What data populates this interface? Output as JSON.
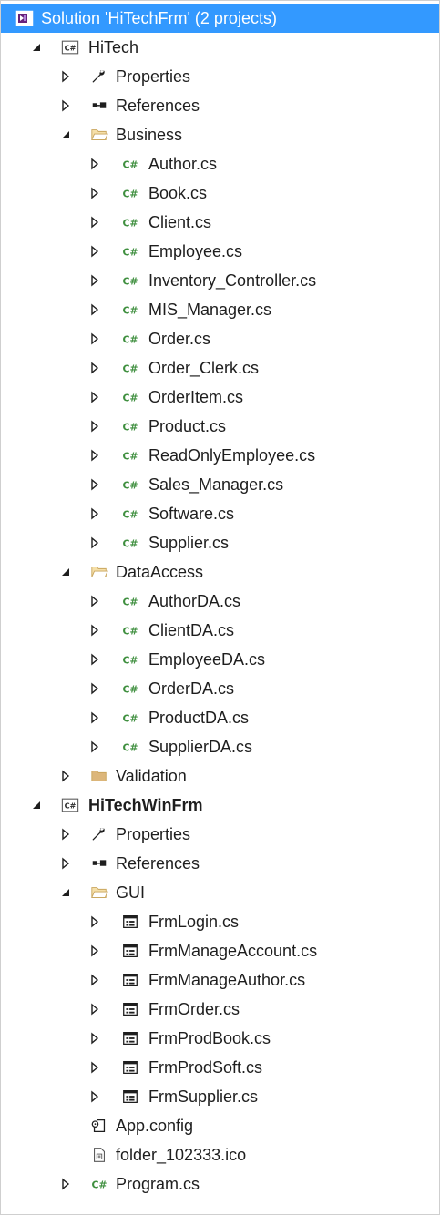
{
  "solution_explorer": {
    "solution": {
      "label": "Solution 'HiTechFrm' (2 projects)",
      "icon": "visual-studio-solution-icon",
      "state": "selected"
    },
    "projects": [
      {
        "label": "HiTech",
        "icon": "csharp-project-icon",
        "expanded": true,
        "bold": false,
        "properties_label": "Properties",
        "references_label": "References",
        "folders": [
          {
            "label": "Business",
            "expanded": true,
            "items": [
              {
                "label": "Author.cs",
                "icon": "csharp-file-icon"
              },
              {
                "label": "Book.cs",
                "icon": "csharp-file-icon"
              },
              {
                "label": "Client.cs",
                "icon": "csharp-file-icon"
              },
              {
                "label": "Employee.cs",
                "icon": "csharp-file-icon"
              },
              {
                "label": "Inventory_Controller.cs",
                "icon": "csharp-file-icon"
              },
              {
                "label": "MIS_Manager.cs",
                "icon": "csharp-file-icon"
              },
              {
                "label": "Order.cs",
                "icon": "csharp-file-icon"
              },
              {
                "label": "Order_Clerk.cs",
                "icon": "csharp-file-icon"
              },
              {
                "label": "OrderItem.cs",
                "icon": "csharp-file-icon"
              },
              {
                "label": "Product.cs",
                "icon": "csharp-file-icon"
              },
              {
                "label": "ReadOnlyEmployee.cs",
                "icon": "csharp-file-icon"
              },
              {
                "label": "Sales_Manager.cs",
                "icon": "csharp-file-icon"
              },
              {
                "label": "Software.cs",
                "icon": "csharp-file-icon"
              },
              {
                "label": "Supplier.cs",
                "icon": "csharp-file-icon"
              }
            ]
          },
          {
            "label": "DataAccess",
            "expanded": true,
            "items": [
              {
                "label": "AuthorDA.cs",
                "icon": "csharp-file-icon"
              },
              {
                "label": "ClientDA.cs",
                "icon": "csharp-file-icon"
              },
              {
                "label": "EmployeeDA.cs",
                "icon": "csharp-file-icon"
              },
              {
                "label": "OrderDA.cs",
                "icon": "csharp-file-icon"
              },
              {
                "label": "ProductDA.cs",
                "icon": "csharp-file-icon"
              },
              {
                "label": "SupplierDA.cs",
                "icon": "csharp-file-icon"
              }
            ]
          },
          {
            "label": "Validation",
            "expanded": false,
            "items": []
          }
        ]
      },
      {
        "label": "HiTechWinFrm",
        "icon": "csharp-project-icon",
        "expanded": true,
        "bold": true,
        "properties_label": "Properties",
        "references_label": "References",
        "folders": [
          {
            "label": "GUI",
            "expanded": true,
            "items": [
              {
                "label": "FrmLogin.cs",
                "icon": "windows-form-icon"
              },
              {
                "label": "FrmManageAccount.cs",
                "icon": "windows-form-icon"
              },
              {
                "label": "FrmManageAuthor.cs",
                "icon": "windows-form-icon"
              },
              {
                "label": "FrmOrder.cs",
                "icon": "windows-form-icon"
              },
              {
                "label": "FrmProdBook.cs",
                "icon": "windows-form-icon"
              },
              {
                "label": "FrmProdSoft.cs",
                "icon": "windows-form-icon"
              },
              {
                "label": "FrmSupplier.cs",
                "icon": "windows-form-icon"
              }
            ]
          }
        ],
        "files": [
          {
            "label": "App.config",
            "icon": "config-file-icon",
            "expander": false
          },
          {
            "label": "folder_102333.ico",
            "icon": "ico-file-icon",
            "expander": false
          },
          {
            "label": "Program.cs",
            "icon": "csharp-file-icon",
            "expander": true
          }
        ]
      }
    ]
  },
  "colors": {
    "selection": "#3399ff",
    "text": "#1e1e1e",
    "csharp_green": "#3f8f3f",
    "folder": "#dcb67a"
  }
}
